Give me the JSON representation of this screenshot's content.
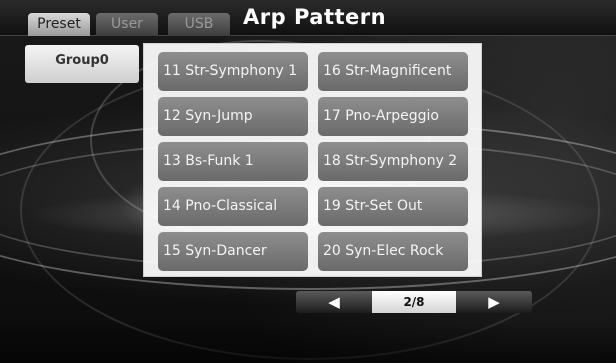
{
  "header": {
    "tabs": [
      {
        "label": "Preset",
        "active": true
      },
      {
        "label": "User",
        "active": false
      },
      {
        "label": "USB",
        "active": false
      }
    ],
    "title": "Arp Pattern"
  },
  "group": {
    "label": "Group0"
  },
  "patterns": [
    "11 Str-Symphony 1",
    "12 Syn-Jump",
    "13 Bs-Funk 1",
    "14 Pno-Classical",
    "15 Syn-Dancer",
    "16 Str-Magnificent",
    "17 Pno-Arpeggio",
    "18 Str-Symphony 2",
    "19 Str-Set Out",
    "20 Syn-Elec Rock"
  ],
  "pager": {
    "prev_icon": "left-arrow-icon",
    "next_icon": "right-arrow-icon",
    "prev_glyph": "◀",
    "next_glyph": "▶",
    "page": "2/8"
  }
}
